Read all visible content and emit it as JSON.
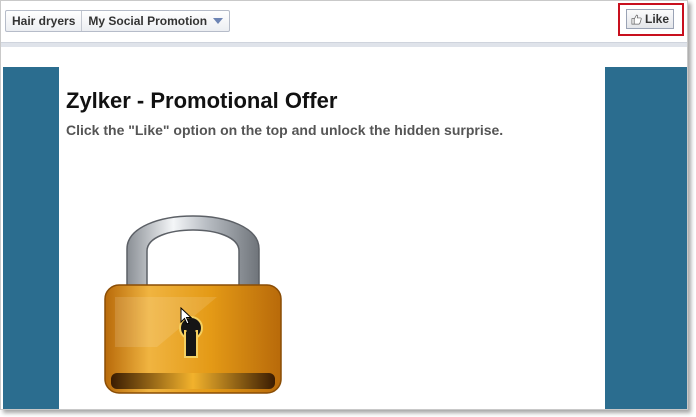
{
  "toolbar": {
    "breadcrumb_first": "Hair dryers",
    "breadcrumb_second": "My Social Promotion",
    "like_label": "Like"
  },
  "promo": {
    "title": "Zylker - Promotional Offer",
    "subtitle": "Click the \"Like\" option on the top and unlock the hidden surprise."
  },
  "icons": {
    "like": "thumbs-up-icon",
    "lock": "padlock-icon",
    "dropdown": "chevron-down-icon",
    "cursor": "mouse-pointer-icon"
  },
  "colors": {
    "side_panel": "#2b6d8f",
    "highlight": "#c8101e",
    "lock_gold": "#e8a21c"
  }
}
